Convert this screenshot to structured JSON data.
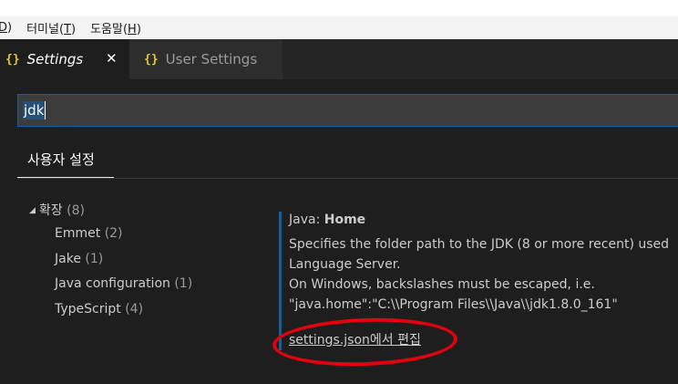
{
  "menu": {
    "items": [
      {
        "prefix": "",
        "mnemonic": "D",
        "suffix": ")"
      },
      {
        "prefix": "터미널(",
        "mnemonic": "T",
        "suffix": ")"
      },
      {
        "prefix": "도움말(",
        "mnemonic": "H",
        "suffix": ")"
      }
    ]
  },
  "tabs": {
    "braces": "{}",
    "active_label": "Settings",
    "close_glyph": "✕",
    "inactive_label": "User Settings"
  },
  "search": {
    "value": "jdk"
  },
  "settings_scope_tab": "사용자 설정",
  "tree": {
    "arrow": "◢",
    "group": {
      "label": "확장",
      "count": "(8)"
    },
    "items": [
      {
        "label": "Emmet",
        "count": "(2)"
      },
      {
        "label": "Jake",
        "count": "(1)"
      },
      {
        "label": "Java configuration",
        "count": "(1)"
      },
      {
        "label": "TypeScript",
        "count": "(4)"
      }
    ]
  },
  "detail": {
    "category": "Java: ",
    "name": "Home",
    "lines": [
      "Specifies the folder path to the JDK (8 or more recent) used",
      "Language Server.",
      "On Windows, backslashes must be escaped, i.e.",
      "\"java.home\":\"C:\\\\Program Files\\\\Java\\\\jdk1.8.0_161\""
    ],
    "edit_link": "settings.json에서 편집"
  },
  "colors": {
    "accent": "#0e639c",
    "brace": "#e8c73b",
    "annotation": "#e3000f"
  }
}
